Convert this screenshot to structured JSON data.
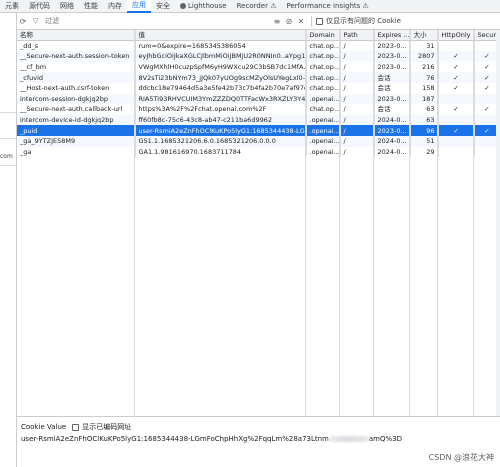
{
  "tabs": [
    {
      "label": "元素",
      "active": false
    },
    {
      "label": "源代码",
      "active": false
    },
    {
      "label": "网络",
      "active": false
    },
    {
      "label": "性能",
      "active": false
    },
    {
      "label": "内存",
      "active": false
    },
    {
      "label": "应用",
      "active": true
    },
    {
      "label": "安全",
      "active": false
    },
    {
      "label": "Lighthouse",
      "active": false
    },
    {
      "label": "Recorder ⚠",
      "active": false
    },
    {
      "label": "Performance insights ⚠",
      "active": false
    }
  ],
  "left_gutter": {
    "label": "com"
  },
  "toolbar": {
    "filter_placeholder": "过滤",
    "only_issues_label": "仅显示有问题的 Cookie"
  },
  "table": {
    "headers": [
      "名称",
      "值",
      "Domain",
      "Path",
      "Expires ...",
      "大小",
      "HttpOnly",
      "Secure"
    ],
    "rows": [
      {
        "name": "_dd_s",
        "value": "rum=0&expire=1685345386054",
        "domain": "chat.op...",
        "path": "/",
        "expires": "2023-0...",
        "size": "31",
        "httponly": "",
        "secure": "",
        "selected": false
      },
      {
        "name": "__Secure-next-auth.session-token",
        "value": "eyJhbGciOiJkaXGLCJlbmMiOiJBMjU2R0NNIn0..aYpg1...",
        "domain": "chat.op...",
        "path": "/",
        "expires": "2023-0...",
        "size": "2807",
        "httponly": "✓",
        "secure": "✓",
        "selected": false
      },
      {
        "name": "__cf_bm",
        "value": "VWgMXhlH0cuzpSpfM6yH9WXcu29C3bSB7dc1MfA...",
        "domain": "chat.op...",
        "path": "/",
        "expires": "2023-0...",
        "size": "216",
        "httponly": "✓",
        "secure": "✓",
        "selected": false
      },
      {
        "name": "_cfuvid",
        "value": "8V2sTi23bNYm73_jJQk07yUOg9scMZyOlsUYegLxl0-...",
        "domain": "chat.op...",
        "path": "/",
        "expires": "会话",
        "size": "76",
        "httponly": "✓",
        "secure": "✓",
        "selected": false
      },
      {
        "name": "__Host-next-auth.csrf-token",
        "value": "ddcbc18e79464d5a3e5fe42b73c7b4fa2b70e7af97ed...",
        "domain": "chat.op...",
        "path": "/",
        "expires": "会话",
        "size": "158",
        "httponly": "✓",
        "secure": "✓",
        "selected": false
      },
      {
        "name": "intercom-session-dgkjq2bp",
        "value": "RIA5Ti93RHVCUIM3YmZZZDQ0TTFacWx3RXZLY3Y4...",
        "domain": ".openai....",
        "path": "/",
        "expires": "2023-0...",
        "size": "187",
        "httponly": "",
        "secure": "",
        "selected": false
      },
      {
        "name": "__Secure-next-auth.callback-url",
        "value": "https%3A%2F%2Fchat.openai.com%2F",
        "domain": "chat.op...",
        "path": "/",
        "expires": "会话",
        "size": "63",
        "httponly": "✓",
        "secure": "✓",
        "selected": false
      },
      {
        "name": "intercom-device-id-dgkjq2bp",
        "value": "ff60fb8c-75c6-43c8-ab47-c211ba6d9962",
        "domain": ".openai....",
        "path": "/",
        "expires": "2024-0...",
        "size": "63",
        "httponly": "",
        "secure": "",
        "selected": false
      },
      {
        "name": "_puid",
        "value": "user-RsmiA2eZnFhOClKuKPo5lyG1:1685344438-LG...",
        "domain": ".openai....",
        "path": "/",
        "expires": "2023-0...",
        "size": "96",
        "httponly": "✓",
        "secure": "✓",
        "selected": true
      },
      {
        "name": "_ga_9YTZJE58M9",
        "value": "GS1.1.1685321206.6.0.1685321206.0.0.0",
        "domain": ".openai....",
        "path": "/",
        "expires": "2024-0...",
        "size": "51",
        "httponly": "",
        "secure": "",
        "selected": false
      },
      {
        "name": "_ga",
        "value": "GA1.1.981616970.1683711784",
        "domain": ".openai....",
        "path": "/",
        "expires": "2024-0...",
        "size": "29",
        "httponly": "",
        "secure": "",
        "selected": false
      }
    ]
  },
  "cookie_value_panel": {
    "title": "Cookie Value",
    "show_decoded_label": "显示已编码网址",
    "value_start": "user-RsmiA2eZnFhOClKuKPo5lyG1:1685344438-LGmFoChpHhXg%2FqqLm%28a73Ltnm",
    "value_end": "amQ%3D"
  },
  "watermark": "CSDN @浪花大神"
}
